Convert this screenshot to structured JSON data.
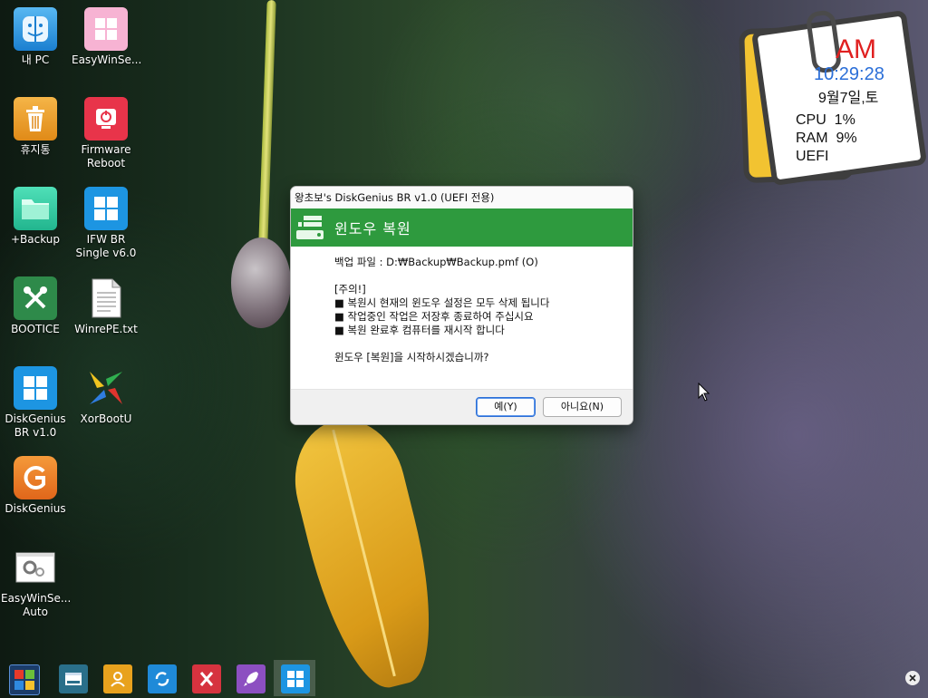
{
  "desktop": {
    "icons": [
      {
        "label": "내 PC",
        "icon": "finder-icon",
        "color": "#3aa0e8"
      },
      {
        "label": "EasyWinSe...",
        "icon": "windows-logo-icon",
        "color": "#f39ac6"
      },
      {
        "label": "휴지통",
        "icon": "trash-icon",
        "color": "#f0a030"
      },
      {
        "label": "Firmware\nReboot",
        "icon": "reboot-icon",
        "color": "#e8344a"
      },
      {
        "label": "+Backup",
        "icon": "folder-icon",
        "color": "#3ecfa6"
      },
      {
        "label": "IFW BR\nSingle v6.0",
        "icon": "windows-logo-icon",
        "color": "#1d95e2"
      },
      {
        "label": "BOOTICE",
        "icon": "tools-icon",
        "color": "#2e8a4a"
      },
      {
        "label": "WinrePE.txt",
        "icon": "text-file-icon",
        "color": "#ffffff"
      },
      {
        "label": "DiskGenius\nBR v1.0",
        "icon": "windows-logo-icon",
        "color": "#1d95e2"
      },
      {
        "label": "XorBootU",
        "icon": "xorboot-icon",
        "color": "#ffffff"
      },
      {
        "label": "DiskGenius",
        "icon": "diskgenius-icon",
        "color": "#f07a1a"
      },
      {
        "label": "EasyWinSe...\nAuto",
        "icon": "settings-window-icon",
        "color": "#ffffff"
      }
    ]
  },
  "clock_widget": {
    "ampm": "AM",
    "time": "10:29:28",
    "date": "9월7일,토",
    "cpu": "CPU  1%",
    "ram": "RAM  9%",
    "mode": "UEFI"
  },
  "dialog": {
    "window_title": "왕초보's DiskGenius BR v1.0 (UEFI 전용)",
    "header_title": "윈도우 복원",
    "backup_file_line": "백업 파일 : D:₩Backup₩Backup.pmf (O)",
    "notice_heading": "[주의!]",
    "notices": [
      "■ 복원시 현재의 윈도우 설정은 모두 삭제 됩니다",
      "■ 작업중인 작업은 저장후 종료하여 주십시요",
      "■ 복원 완료후 컴퓨터를 재시작 합니다"
    ],
    "question": "윈도우 [복원]을  시작하시겠습니까?",
    "yes_label": "예(Y)",
    "no_label": "아니요(N)"
  },
  "taskbar": {
    "items": [
      {
        "icon": "start-icon"
      },
      {
        "icon": "window-icon",
        "color": "#2a6f8a"
      },
      {
        "icon": "user-icon",
        "color": "#e8a21e"
      },
      {
        "icon": "sync-icon",
        "color": "#1f8ad8"
      },
      {
        "icon": "x-app-icon",
        "color": "#d6333f"
      },
      {
        "icon": "rocket-icon",
        "color": "#8c4fc1"
      },
      {
        "icon": "windows-logo-icon",
        "color": "#1d95e2"
      }
    ]
  },
  "colors": {
    "dialog_header": "#2e9a3e",
    "clock_time": "#2b6fd8",
    "clock_ampm": "#e02020"
  }
}
